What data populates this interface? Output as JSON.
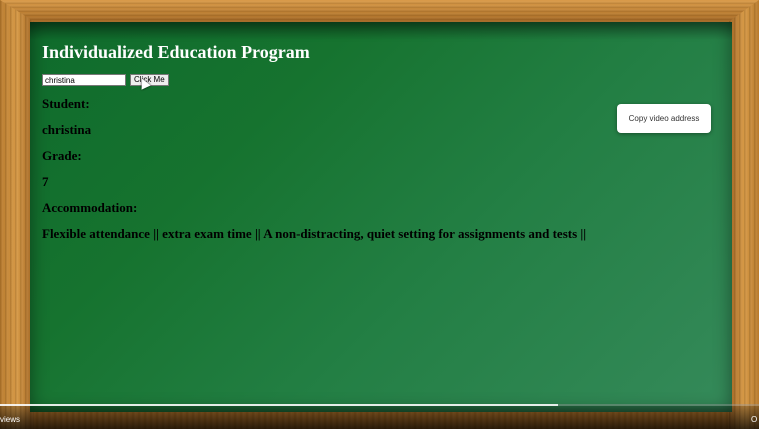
{
  "page": {
    "title": "Individualized Education Program"
  },
  "form": {
    "name_value": "christina",
    "button_label": "Click Me"
  },
  "record": {
    "student_label": "Student:",
    "student_value": "christina",
    "grade_label": "Grade:",
    "grade_value": "7",
    "accommodation_label": "Accommodation:",
    "accommodation_value": "Flexible attendance || extra exam time || A non-distracting, quiet setting for assignments and tests ||"
  },
  "context_menu": {
    "item_label": "Copy video address"
  },
  "video_bar": {
    "left_text": "views",
    "right_text": "O",
    "progress_fraction": 0.735
  },
  "colors": {
    "board": "#16732f",
    "frame": "#c98a3a",
    "title_text": "#ffffff"
  },
  "icons": {
    "cursor": "mouse-pointer-icon"
  }
}
